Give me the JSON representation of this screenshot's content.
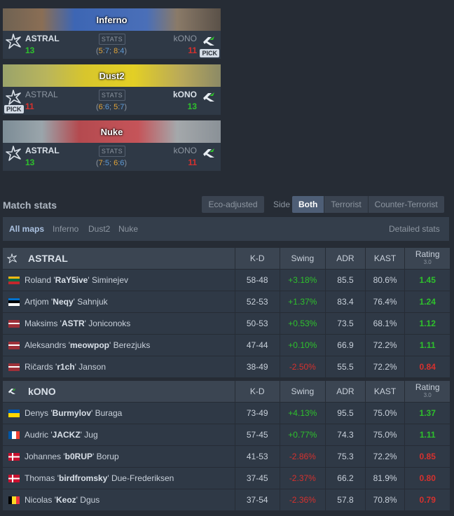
{
  "maps": [
    {
      "name": "Inferno",
      "left_team": "ASTRAL",
      "left_score": "13",
      "right_team": "kONO",
      "right_score": "11",
      "stats_label": "STATS",
      "half1_t": "5",
      "half1_ct": "7",
      "half2_t": "8",
      "half2_ct": "4",
      "left_winner": true,
      "pick": "right",
      "pick_label": "PICK"
    },
    {
      "name": "Dust2",
      "left_team": "ASTRAL",
      "left_score": "11",
      "right_team": "kONO",
      "right_score": "13",
      "stats_label": "STATS",
      "half1_t": "6",
      "half1_ct": "6",
      "half2_t": "5",
      "half2_ct": "7",
      "left_winner": false,
      "pick": "left",
      "pick_label": "PICK"
    },
    {
      "name": "Nuke",
      "left_team": "ASTRAL",
      "left_score": "13",
      "right_team": "kONO",
      "right_score": "11",
      "stats_label": "STATS",
      "half1_t": "7",
      "half1_ct": "5",
      "half2_t": "6",
      "half2_ct": "6",
      "left_winner": true,
      "pick": "",
      "pick_label": ""
    }
  ],
  "match_stats": {
    "title": "Match stats",
    "eco_adjusted": "Eco-adjusted",
    "side_label": "Side",
    "side_options": [
      "Both",
      "Terrorist",
      "Counter-Terrorist"
    ],
    "filters": [
      "All maps",
      "Inferno",
      "Dust2",
      "Nuke"
    ],
    "detailed": "Detailed stats"
  },
  "columns": {
    "kd": "K-D",
    "swing": "Swing",
    "adr": "ADR",
    "kast": "KAST",
    "rating": "Rating",
    "rating_ver": "3.0"
  },
  "teams": [
    {
      "name": "ASTRAL",
      "players": [
        {
          "first": "Roland",
          "nick": "RaY5ive",
          "last": "Siminejev",
          "flag": "lt",
          "kd": "58-48",
          "swing": "+3.18%",
          "adr": "85.5",
          "kast": "80.6%",
          "rating": "1.45"
        },
        {
          "first": "Artjom",
          "nick": "Neqy",
          "last": "Sahnjuk",
          "flag": "ee",
          "kd": "52-53",
          "swing": "+1.37%",
          "adr": "83.4",
          "kast": "76.4%",
          "rating": "1.24"
        },
        {
          "first": "Maksims",
          "nick": "ASTR",
          "last": "Joniconoks",
          "flag": "lv",
          "kd": "50-53",
          "swing": "+0.53%",
          "adr": "73.5",
          "kast": "68.1%",
          "rating": "1.12"
        },
        {
          "first": "Aleksandrs",
          "nick": "meowpop",
          "last": "Berezjuks",
          "flag": "lv",
          "kd": "47-44",
          "swing": "+0.10%",
          "adr": "66.9",
          "kast": "72.2%",
          "rating": "1.11"
        },
        {
          "first": "Ričards",
          "nick": "r1ch",
          "last": "Janson",
          "flag": "lv",
          "kd": "38-49",
          "swing": "-2.50%",
          "adr": "55.5",
          "kast": "72.2%",
          "rating": "0.84"
        }
      ]
    },
    {
      "name": "kONO",
      "players": [
        {
          "first": "Denys",
          "nick": "Burmylov",
          "last": "Buraga",
          "flag": "ua",
          "kd": "73-49",
          "swing": "+4.13%",
          "adr": "95.5",
          "kast": "75.0%",
          "rating": "1.37"
        },
        {
          "first": "Audric",
          "nick": "JACKZ",
          "last": "Jug",
          "flag": "fr",
          "kd": "57-45",
          "swing": "+0.77%",
          "adr": "74.3",
          "kast": "75.0%",
          "rating": "1.11"
        },
        {
          "first": "Johannes",
          "nick": "b0RUP",
          "last": "Borup",
          "flag": "dk",
          "kd": "41-53",
          "swing": "-2.86%",
          "adr": "75.3",
          "kast": "72.2%",
          "rating": "0.85"
        },
        {
          "first": "Thomas",
          "nick": "birdfromsky",
          "last": "Due-Frederiksen",
          "flag": "dk",
          "kd": "37-45",
          "swing": "-2.37%",
          "adr": "66.2",
          "kast": "81.9%",
          "rating": "0.80"
        },
        {
          "first": "Nicolas",
          "nick": "Keoz",
          "last": "Dgus",
          "flag": "be",
          "kd": "37-54",
          "swing": "-2.36%",
          "adr": "57.8",
          "kast": "70.8%",
          "rating": "0.79"
        }
      ]
    }
  ],
  "colors": {
    "positive": "#2ec12c",
    "negative": "#d6312e",
    "t_side": "#e0a43a",
    "ct_side": "#5f9bd7"
  }
}
